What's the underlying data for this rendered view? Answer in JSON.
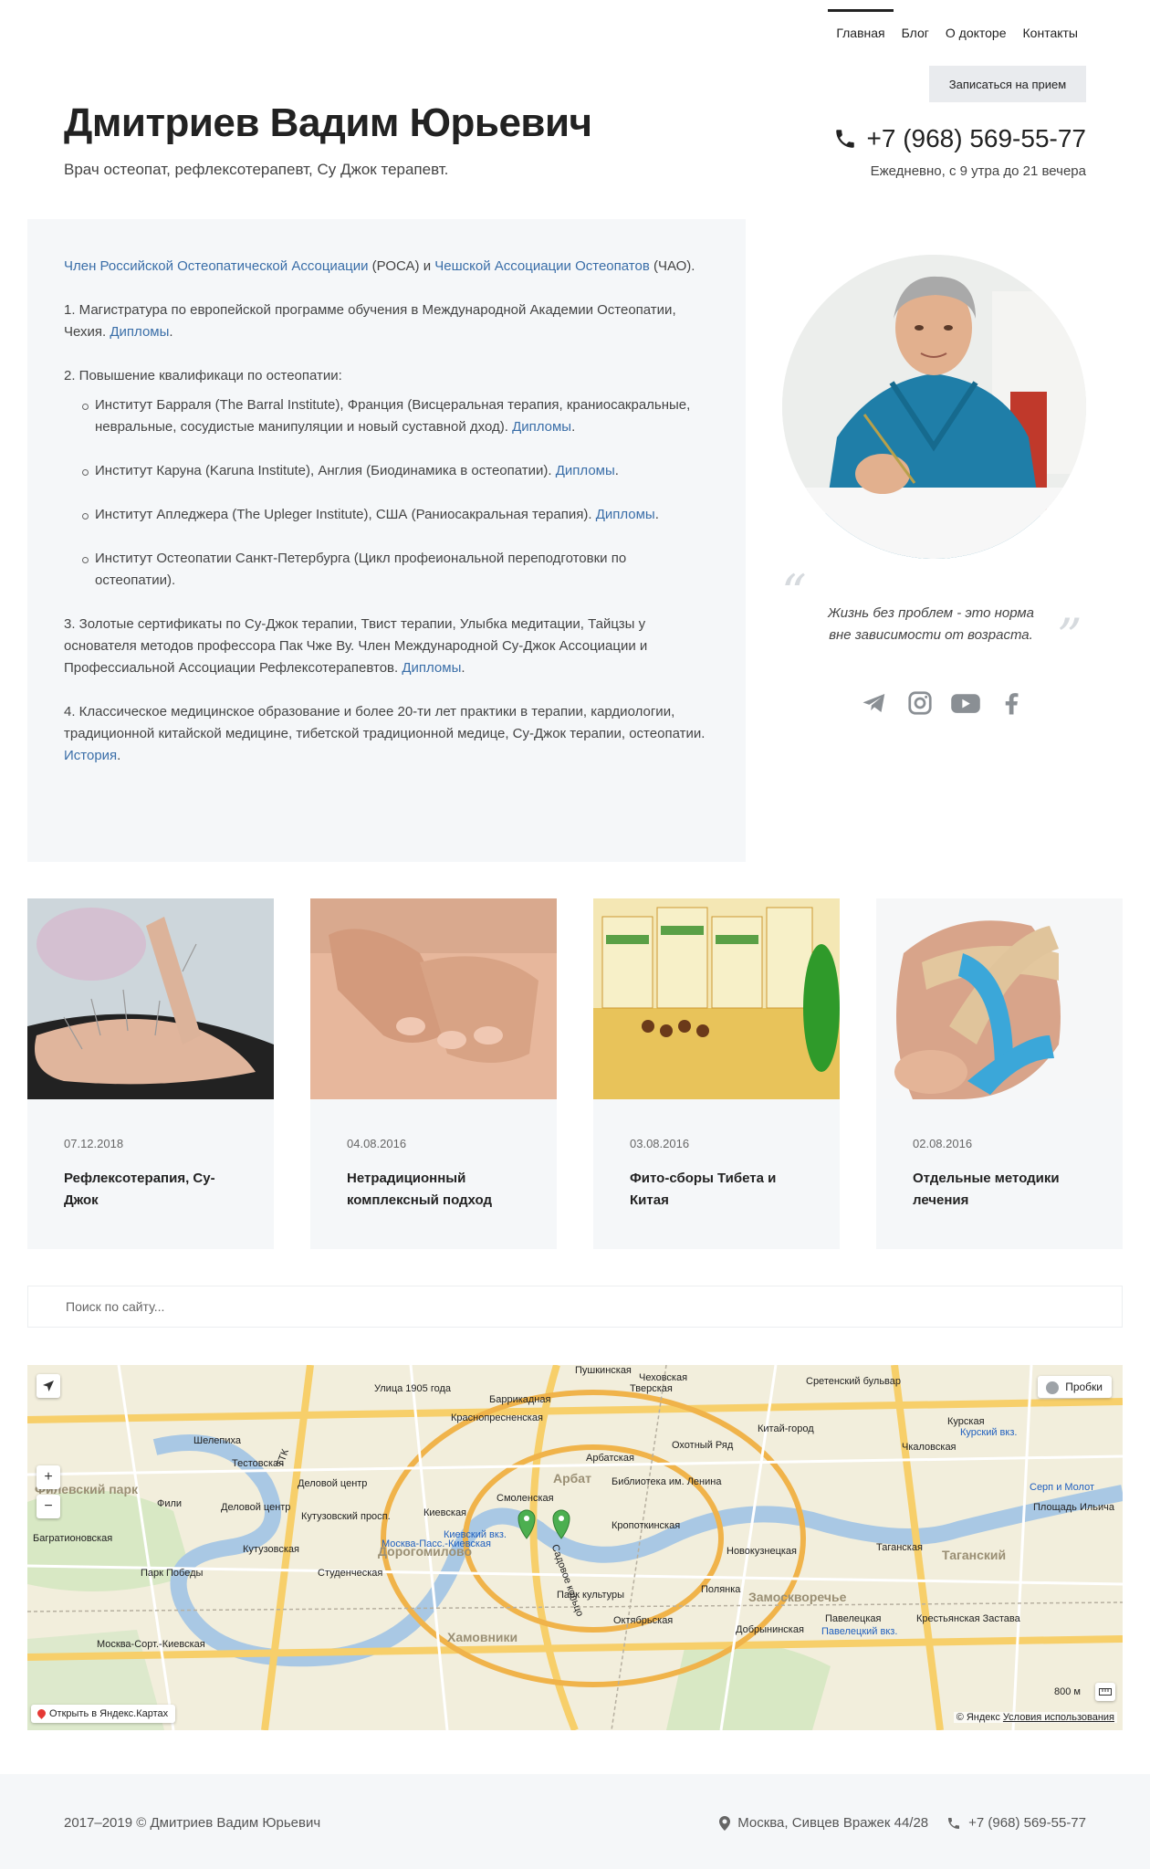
{
  "nav": {
    "items": [
      {
        "label": "Главная",
        "active": true
      },
      {
        "label": "Блог",
        "active": false
      },
      {
        "label": "О докторе",
        "active": false
      },
      {
        "label": "Контакты",
        "active": false
      }
    ],
    "cta": "Записаться на прием"
  },
  "header": {
    "title": "Дмитриев Вадим Юрьевич",
    "subtitle": "Врач остеопат, рефлексотерапевт, Су Джок терапевт.",
    "phone": "+7 (968) 569-55-77",
    "hours": "Ежедневно, с 9 утра до 21 вечера"
  },
  "bio": {
    "intro_link1": "Член Российской Остеопатической Ассоциации",
    "intro_mid": " (РОСА) и ",
    "intro_link2": "Чешской Ассоциации Остеопатов",
    "intro_end": " (ЧАО).",
    "item1_text": "1. Магистратура по европейской программе обучения в Международной Академии Остеопатии, Чехия. ",
    "item1_link": "Дипломы",
    "item2_text": "2. Повышение квалификаци по остеопатии:",
    "sub1_text": "Институт Барраля (The Barral Institute), Франция (Висцеральная терапия, краниосакральные, невральные, сосудистые манипуляции и новый суставной дход). ",
    "sub1_link": "Дипломы",
    "sub2_text": "Институт Каруна (Karuna Institute), Англия (Биодинамика в остеопатии). ",
    "sub2_link": "Дипломы",
    "sub3_text": "Институт Апледжера (The Upleger Institute), США (Раниосакральная терапия). ",
    "sub3_link": "Дипломы",
    "sub4_text": "Институт Остеопатии Санкт-Петербурга (Цикл профеиональной переподготовки по остеопатии).",
    "item3_text": "3. Золотые сертификаты по Су-Джок терапии, Твист терапии, Улыбка медитации, Тайцзы у основателя методов профессора Пак Чже Ву. Член Международной Су-Джок Ассоциации и Профессиальной Ассоциации Рефлексотерапевтов. ",
    "item3_link": "Дипломы",
    "item4_text": "4. Классическое медицинское образование и более 20-ти лет практики в терапии, кардиологии, традиционной китайской медицине, тибетской традиционной медице, Су-Джок терапии, остеопатии. ",
    "item4_link": "История",
    "dot": "."
  },
  "quote": {
    "line1": "Жизнь без проблем - это норма",
    "line2": "вне зависимости от возраста.",
    "open_mark": "“",
    "close_mark": "”"
  },
  "social": [
    "telegram-icon",
    "instagram-icon",
    "youtube-icon",
    "facebook-icon"
  ],
  "cards": [
    {
      "date": "07.12.2018",
      "title": "Рефлексотерапия, Су-Джок"
    },
    {
      "date": "04.08.2016",
      "title": "Нетрадиционный комплексный подход"
    },
    {
      "date": "03.08.2016",
      "title": "Фито-сборы Тибета и Китая"
    },
    {
      "date": "02.08.2016",
      "title": "Отдельные методики лечения"
    }
  ],
  "search": {
    "placeholder": "Поиск по сайту..."
  },
  "map": {
    "probki": "Пробки",
    "open": "Открыть в Яндекс.Картах",
    "copyright": "© Яндекс",
    "terms": "Условия использования",
    "scale": "800 м",
    "zoom_in": "+",
    "zoom_out": "−",
    "labels": {
      "l1": "Пушкинская",
      "l2": "Чеховская",
      "l3": "Тверская",
      "l4": "Сретенский бульвар",
      "l5": "Улица 1905 года",
      "l6": "Баррикадная",
      "l7": "Краснопресненская",
      "l8": "Шелепиха",
      "l9": "Тестовская",
      "l10": "Деловой центр",
      "l11": "Охотный Ряд",
      "l12": "Китай-город",
      "l13": "Курская",
      "l14": "Курский вкз.",
      "l15": "Чкаловская",
      "l16": "Арбатская",
      "l17": "Библиотека им. Ленина",
      "l18": "Арбат",
      "l19": "Смоленская",
      "l20": "Киевская",
      "l21": "Киевский вкз.",
      "l22": "Москва-Пасс.-Киевская",
      "l23": "Дорогомилово",
      "l24": "Кропоткинская",
      "l25": "Фили",
      "l26": "Багратионовская",
      "l27": "Кутузовская",
      "l28": "Парк Победы",
      "l29": "Студенческая",
      "l30": "Кутузовский просп.",
      "l31": "Новокузнецкая",
      "l32": "Таганская",
      "l33": "Таганский",
      "l34": "Полянка",
      "l35": "Замоскворечье",
      "l36": "Павелецкая",
      "l37": "Павелецкий вкз.",
      "l38": "Крестьянская Застава",
      "l39": "Хамовники",
      "l40": "Октябрьская",
      "l41": "Парк культуры",
      "l42": "Серп и Молот",
      "l43": "Площадь Ильича",
      "l44": "Филевский парк",
      "l45": "Садовое кольцо",
      "l46": "ТТК",
      "l47": "Деловой центр",
      "l48": "Добрынинская",
      "l49": "Москва-Сорт.-Киевская",
      "l50": "Площадь Ильича"
    }
  },
  "footer": {
    "copyright": "2017–2019 © Дмитриев Вадим Юрьевич",
    "address": "Москва, Сивцев Вражек 44/28",
    "phone": "+7 (968) 569-55-77"
  },
  "colors": {
    "link": "#3a6ea8",
    "panel": "#f5f7f9",
    "text": "#333333"
  }
}
